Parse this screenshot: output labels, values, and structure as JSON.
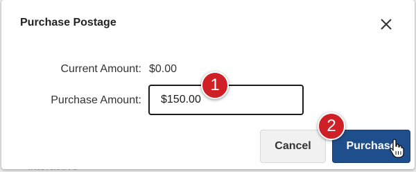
{
  "dialog": {
    "title": "Purchase Postage",
    "close_icon": "close-x-icon"
  },
  "backdrop": {
    "partial_text": "interactive"
  },
  "form": {
    "current_amount_label": "Current Amount:",
    "current_amount_value": "$0.00",
    "purchase_amount_label": "Purchase Amount:",
    "purchase_amount_value": "$150.00"
  },
  "buttons": {
    "cancel_label": "Cancel",
    "purchase_label": "Purchase"
  },
  "annotations": {
    "step1": "1",
    "step2": "2"
  },
  "colors": {
    "primary": "#1f4e8c",
    "badge": "#cf2027"
  },
  "cursor": "hand-pointer-icon"
}
